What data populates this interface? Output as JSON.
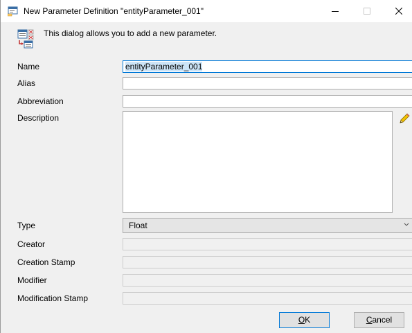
{
  "window": {
    "title": "New Parameter Definition \"entityParameter_001\"",
    "info_text": "This dialog allows you to add a new parameter."
  },
  "form": {
    "name_label": "Name",
    "name_value": "entityParameter_001",
    "alias_label": "Alias",
    "alias_value": "",
    "abbreviation_label": "Abbreviation",
    "abbreviation_value": "",
    "description_label": "Description",
    "description_value": "",
    "type_label": "Type",
    "type_value": "Float",
    "creator_label": "Creator",
    "creator_value": "",
    "creation_stamp_label": "Creation Stamp",
    "creation_stamp_value": "",
    "modifier_label": "Modifier",
    "modifier_value": "",
    "modification_stamp_label": "Modification Stamp",
    "modification_stamp_value": ""
  },
  "buttons": {
    "ok_accel": "O",
    "ok_rest": "K",
    "cancel_accel": "C",
    "cancel_rest": "ancel"
  },
  "colors": {
    "accent": "#0078d7",
    "selection": "#cce4f7",
    "dialog_bg": "#f0f0f0"
  },
  "icons": {
    "title": "dialog-window-icon",
    "info": "add-parameter-icon",
    "edit": "pencil-icon",
    "dropdown": "chevron-down-icon"
  }
}
